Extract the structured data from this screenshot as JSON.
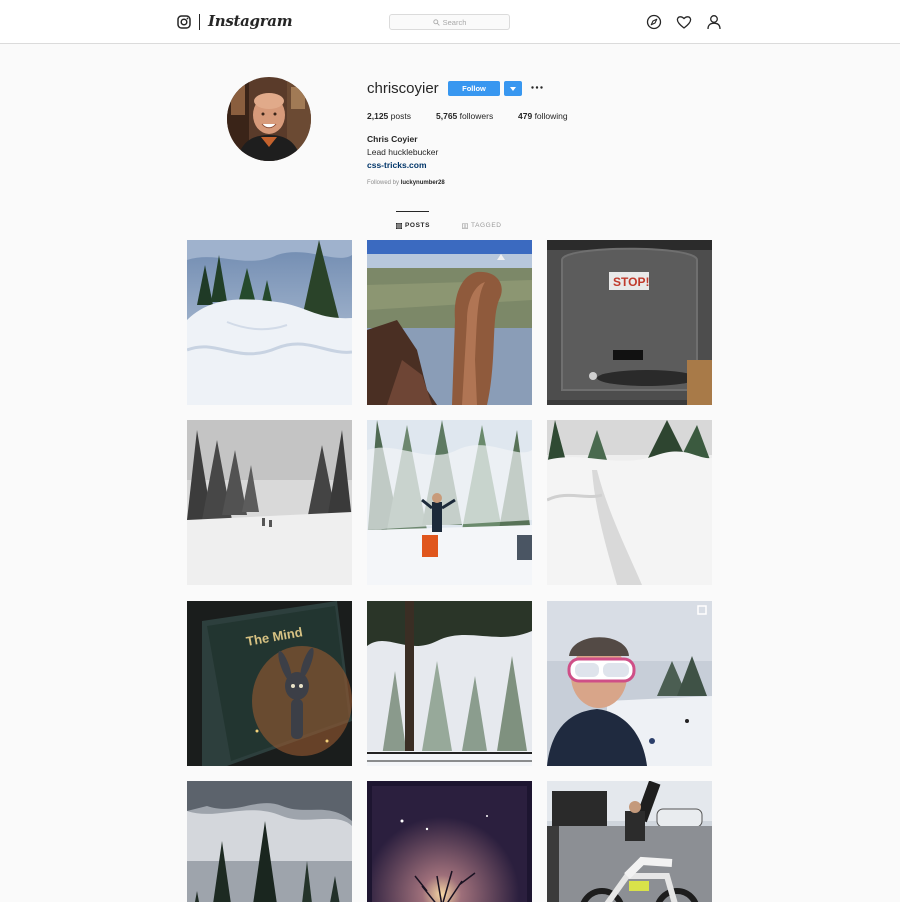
{
  "nav": {
    "brand": "Instagram",
    "search_placeholder": "Search",
    "icons": [
      "camera-icon",
      "compass-icon",
      "heart-icon",
      "user-icon"
    ]
  },
  "profile": {
    "username": "chriscoyier",
    "follow_label": "Follow",
    "stats": {
      "posts_count": "2,125",
      "posts_label": "posts",
      "followers_count": "5,765",
      "followers_label": "followers",
      "following_count": "479",
      "following_label": "following"
    },
    "full_name": "Chris Coyier",
    "bio": "Lead hucklebucker",
    "website": "css-tricks.com",
    "followed_by_prefix": "Followed by",
    "followed_by_user": "luckynumber28"
  },
  "tabs": {
    "posts": "POSTS",
    "tagged": "TAGGED"
  },
  "colors": {
    "accent": "#3897f0",
    "link": "#003569",
    "border": "#dbdbdb",
    "background": "#fafafa"
  }
}
